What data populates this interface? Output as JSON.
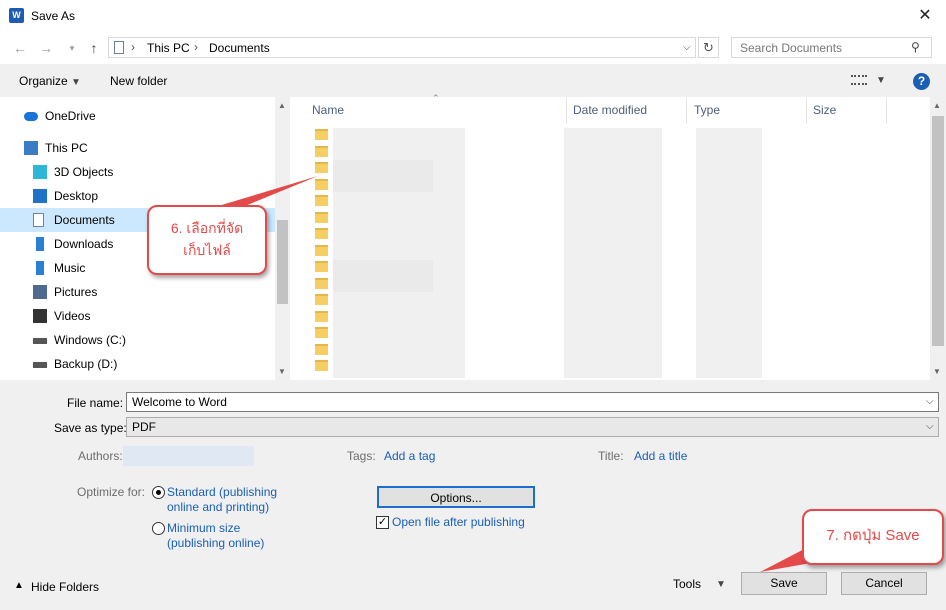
{
  "window": {
    "title": "Save As",
    "app_icon": "W"
  },
  "nav": {
    "breadcrumb": [
      "This PC",
      "Documents"
    ],
    "search_placeholder": "Search Documents"
  },
  "toolbar": {
    "organize": "Organize",
    "new_folder": "New folder"
  },
  "sidebar": {
    "items": [
      {
        "label": "OneDrive",
        "icon": "cloud-icon"
      },
      {
        "label": "This PC",
        "icon": "computer-icon"
      },
      {
        "label": "3D Objects",
        "icon": "cube-icon"
      },
      {
        "label": "Desktop",
        "icon": "desktop-icon"
      },
      {
        "label": "Documents",
        "icon": "document-icon",
        "selected": true
      },
      {
        "label": "Downloads",
        "icon": "download-icon"
      },
      {
        "label": "Music",
        "icon": "music-icon"
      },
      {
        "label": "Pictures",
        "icon": "picture-icon"
      },
      {
        "label": "Videos",
        "icon": "video-icon"
      },
      {
        "label": "Windows (C:)",
        "icon": "drive-icon"
      },
      {
        "label": "Backup (D:)",
        "icon": "drive-icon"
      }
    ]
  },
  "columns": {
    "name": "Name",
    "date": "Date modified",
    "type": "Type",
    "size": "Size"
  },
  "form": {
    "file_name_label": "File name:",
    "file_name_value": "Welcome to Word",
    "save_type_label": "Save as type:",
    "save_type_value": "PDF",
    "authors_label": "Authors:",
    "tags_label": "Tags:",
    "tags_link": "Add a tag",
    "title_label": "Title:",
    "title_link": "Add a title",
    "optimize_label": "Optimize for:",
    "opt_standard_1": "Standard (publishing",
    "opt_standard_2": "online and printing)",
    "opt_min_1": "Minimum size",
    "opt_min_2": "(publishing online)",
    "options_button": "Options...",
    "open_after": "Open file after publishing"
  },
  "footer": {
    "hide_folders": "Hide Folders",
    "tools": "Tools",
    "save": "Save",
    "cancel": "Cancel"
  },
  "annotations": {
    "step6_line1": "6. เลือกที่จัด",
    "step6_line2": "เก็บไฟล์",
    "step7": "7. กดปุ่ม Save"
  },
  "colors": {
    "accent": "#1a5fb4",
    "callout": "#e44a4a",
    "selected": "#cce8ff"
  }
}
